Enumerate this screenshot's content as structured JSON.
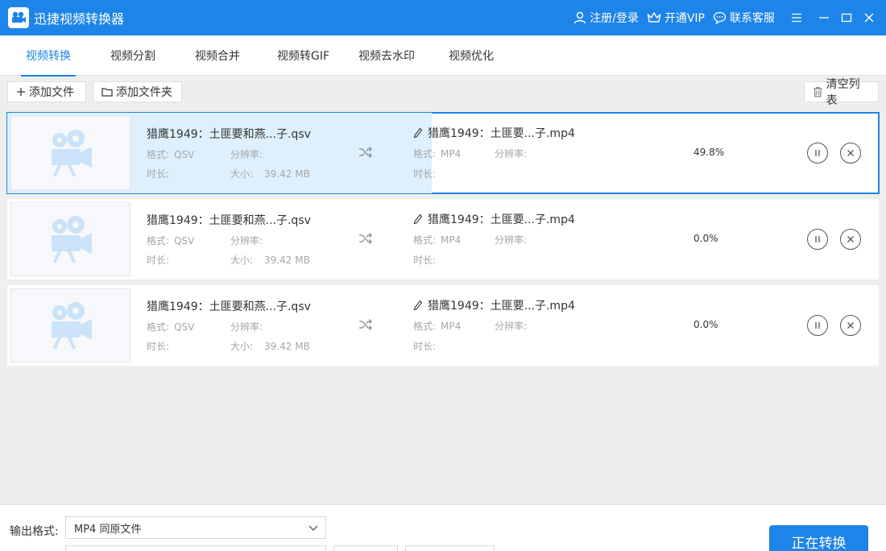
{
  "app": {
    "title": "迅捷视频转换器"
  },
  "titlebar": {
    "login_label": "注册/登录",
    "vip_label": "开通VIP",
    "service_label": "联系客服"
  },
  "tabs": [
    {
      "label": "视频转换",
      "active": true
    },
    {
      "label": "视频分割"
    },
    {
      "label": "视频合并"
    },
    {
      "label": "视频转GIF"
    },
    {
      "label": "视频去水印"
    },
    {
      "label": "视频优化"
    }
  ],
  "toolbar": {
    "add_file_label": "添加文件",
    "add_folder_label": "添加文件夹",
    "clear_list_label": "清空列表"
  },
  "labels": {
    "format": "格式:",
    "resolution": "分辨率:",
    "duration": "时长:",
    "size": "大小:"
  },
  "files": [
    {
      "source_name": "猎鹰1949：土匪要和燕...子.qsv",
      "source_format": "QSV",
      "source_size": "39.42 MB",
      "output_name": "猎鹰1949：土匪要...子.mp4",
      "output_format": "MP4",
      "progress_text": "49.8%",
      "progress": 0.498,
      "selected": true
    },
    {
      "source_name": "猎鹰1949：土匪要和燕...子.qsv",
      "source_format": "QSV",
      "source_size": "39.42 MB",
      "output_name": "猎鹰1949：土匪要...子.mp4",
      "output_format": "MP4",
      "progress_text": "0.0%",
      "progress": 0.0,
      "selected": false
    },
    {
      "source_name": "猎鹰1949：土匪要和燕...子.qsv",
      "source_format": "QSV",
      "source_size": "39.42 MB",
      "output_name": "猎鹰1949：土匪要...子.mp4",
      "output_format": "MP4",
      "progress_text": "0.0%",
      "progress": 0.0,
      "selected": false
    }
  ],
  "bottom": {
    "output_format_label": "输出格式:",
    "output_format_value": "MP4  同原文件",
    "convert_label": "正在转换"
  },
  "colors": {
    "accent": "#1d84e9",
    "progress_fill": "#def0fd",
    "meta_text": "#a6a6a6"
  }
}
